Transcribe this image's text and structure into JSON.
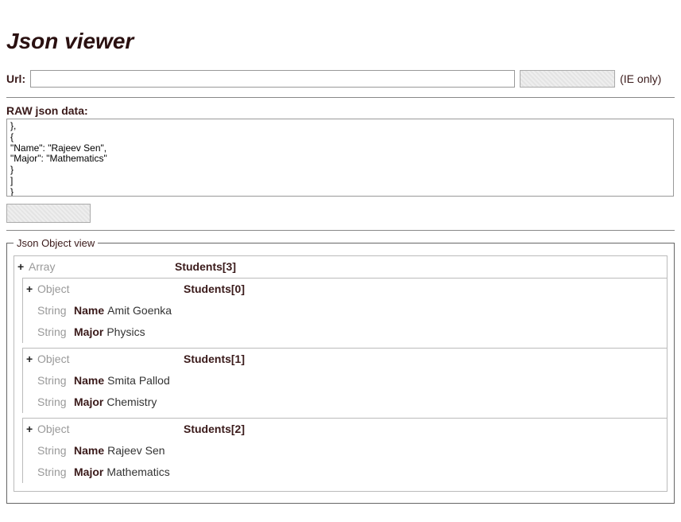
{
  "title": "Json viewer",
  "url_label": "Url:",
  "url_value": "",
  "get_button_label": " ",
  "ie_only_label": "(IE only)",
  "raw_label": "RAW json data:",
  "raw_text": "},\n{\n\"Name\": \"Rajeev Sen\",\n\"Major\": \"Mathematics\"\n}\n]\n}",
  "parse_button_label": " ",
  "objview_legend": "Json Object view",
  "types": {
    "array": "Array",
    "object": "Object",
    "string": "String"
  },
  "expander": "+",
  "tree": {
    "root_label": "Students[3]",
    "items": [
      {
        "label": "Students[0]",
        "props": [
          {
            "key": "Name",
            "value": "Amit Goenka"
          },
          {
            "key": "Major",
            "value": "Physics"
          }
        ]
      },
      {
        "label": "Students[1]",
        "props": [
          {
            "key": "Name",
            "value": "Smita Pallod"
          },
          {
            "key": "Major",
            "value": "Chemistry"
          }
        ]
      },
      {
        "label": "Students[2]",
        "props": [
          {
            "key": "Name",
            "value": "Rajeev Sen"
          },
          {
            "key": "Major",
            "value": "Mathematics"
          }
        ]
      }
    ]
  },
  "chart_data": {
    "type": "table",
    "title": "Students",
    "columns": [
      "Name",
      "Major"
    ],
    "rows": [
      [
        "Amit Goenka",
        "Physics"
      ],
      [
        "Smita Pallod",
        "Chemistry"
      ],
      [
        "Rajeev Sen",
        "Mathematics"
      ]
    ]
  }
}
